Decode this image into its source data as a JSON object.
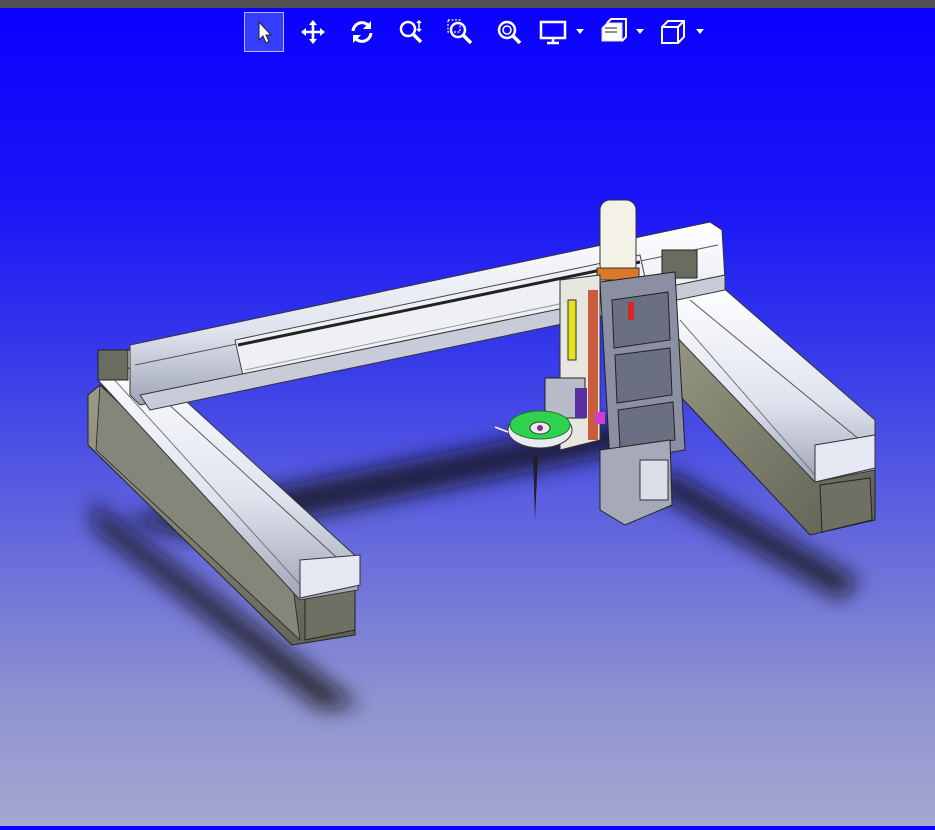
{
  "window": {
    "title": ""
  },
  "toolbar": {
    "active_tool": "select",
    "buttons": [
      {
        "id": "select",
        "icon": "select-arrow-icon"
      },
      {
        "id": "pan",
        "icon": "pan-move-icon"
      },
      {
        "id": "rotate",
        "icon": "rotate-icon"
      },
      {
        "id": "zoom",
        "icon": "zoom-icon"
      },
      {
        "id": "zoom-window",
        "icon": "zoom-window-icon"
      },
      {
        "id": "zoom-fit",
        "icon": "zoom-fit-icon"
      },
      {
        "id": "display-mode",
        "icon": "monitor-icon",
        "dropdown": true
      },
      {
        "id": "view-style",
        "icon": "layers-icon",
        "dropdown": true
      },
      {
        "id": "view-orientation",
        "icon": "cube-icon",
        "dropdown": true
      }
    ]
  },
  "viewport": {
    "background_top": "#0a00ff",
    "background_bottom": "#a4a8cf",
    "model": "gantry-robot-cad-model"
  }
}
